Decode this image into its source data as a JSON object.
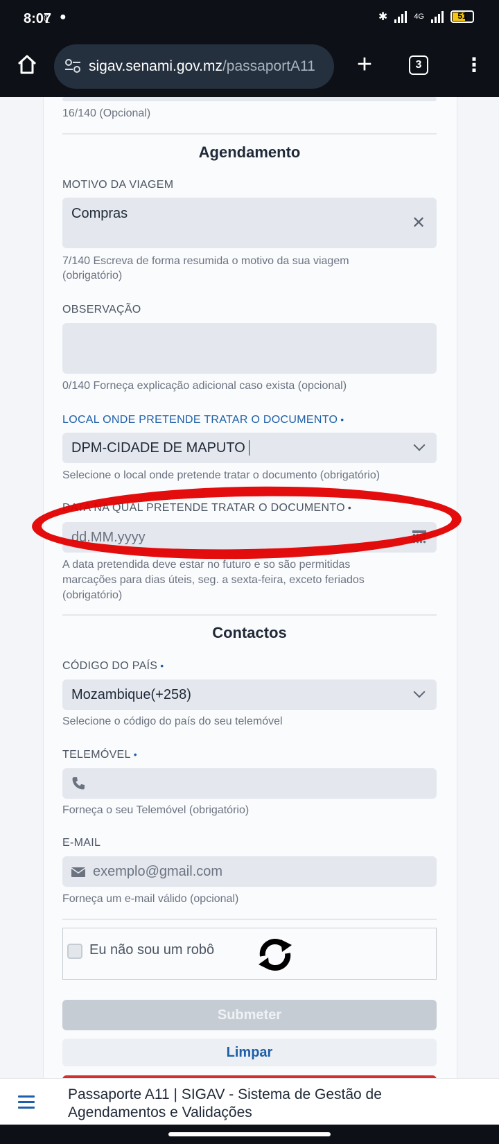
{
  "status": {
    "time": "8:07",
    "network": "4G",
    "battery": "51"
  },
  "browser": {
    "url_host": "sigav.senami.gov.mz",
    "url_path": "/passaportA11",
    "tab_count": "3"
  },
  "form": {
    "prev_hint": "16/140 (Opcional)",
    "agendamento": {
      "title": "Agendamento",
      "motivo": {
        "label": "MOTIVO DA VIAGEM",
        "value": "Compras",
        "hint_line1": "7/140 Escreva de forma resumida o motivo da sua viagem",
        "hint_line2": "(obrigatório)"
      },
      "observacao": {
        "label": "OBSERVAÇÃO",
        "value": "",
        "hint": "0/140 Forneça explicação adicional caso exista (opcional)"
      },
      "local": {
        "label": "LOCAL ONDE PRETENDE TRATAR O DOCUMENTO",
        "required_mark": "•",
        "value": "DPM-CIDADE DE MAPUTO",
        "hint": "Selecione o local onde pretende tratar o documento (obrigatório)"
      },
      "data": {
        "label": "DATA NA QUAL PRETENDE TRATAR O DOCUMENTO",
        "required_mark": "•",
        "placeholder": "dd.MM.yyyy",
        "hint_line1": "A data pretendida deve estar no futuro e so são permitidas",
        "hint_line2": "marcações para dias úteis, seg. a sexta-feira, exceto feriados",
        "hint_line3": "(obrigatório)"
      }
    },
    "contactos": {
      "title": "Contactos",
      "pais": {
        "label": "CÓDIGO DO PAÍS",
        "required_mark": "•",
        "value": "Mozambique(+258)",
        "hint": "Selecione o código do país do seu telemóvel"
      },
      "telemovel": {
        "label": "TELEMÓVEL",
        "required_mark": "•",
        "value": "",
        "hint": "Forneça o seu Telemóvel (obrigatório)"
      },
      "email": {
        "label": "E-MAIL",
        "placeholder": "exemplo@gmail.com",
        "hint": "Forneça um e-mail válido (opcional)"
      }
    },
    "captcha": {
      "label": "Eu não sou um robô",
      "checked": false
    },
    "buttons": {
      "submit": "Submeter",
      "clear": "Limpar"
    }
  },
  "footer": {
    "title_line1": "Passaporte A11 | SIGAV - Sistema de Gestão de",
    "title_line2": "Agendamentos e Validações"
  },
  "colors": {
    "accent": "#1d5fa8",
    "annotation": "#e10000",
    "danger": "#d32f2f"
  }
}
